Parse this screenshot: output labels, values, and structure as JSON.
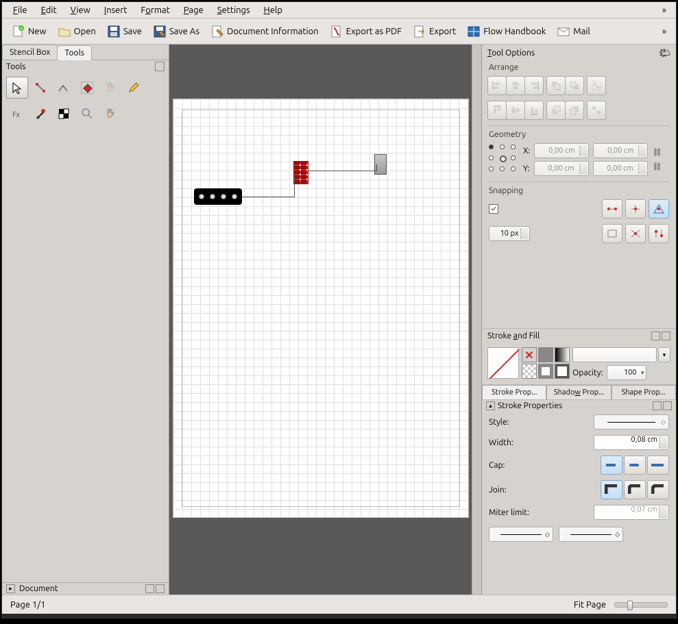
{
  "menu": {
    "items": [
      "File",
      "Edit",
      "View",
      "Insert",
      "Format",
      "Page",
      "Settings",
      "Help"
    ],
    "underline_index": [
      0,
      0,
      0,
      0,
      1,
      0,
      0,
      0
    ]
  },
  "toolbar": {
    "new": "New",
    "open": "Open",
    "save": "Save",
    "save_as": "Save As",
    "doc_info": "Document Information",
    "export_pdf": "Export as PDF",
    "export": "Export",
    "handbook": "Flow Handbook",
    "mail": "Mail"
  },
  "left": {
    "tabs": [
      "Stencil Box",
      "Tools"
    ],
    "active_tab": 1,
    "panel_title": "Tools",
    "doc_panel_title": "Document"
  },
  "tool_options": {
    "title": "Tool Options",
    "arrange_label": "Arrange",
    "geometry_label": "Geometry",
    "x_label": "X:",
    "y_label": "Y:",
    "x1": "0,00 cm",
    "y1": "0,00 cm",
    "x2": "0,00 cm",
    "y2": "0,00 cm",
    "snapping_label": "Snapping",
    "snap_checked": true,
    "snap_distance": "10 px"
  },
  "stroke_fill": {
    "title": "Stroke and Fill",
    "opacity_label": "Opacity:",
    "opacity_value": "100",
    "tabs": [
      "Stroke Prop...",
      "Shadow Prop...",
      "Shape Prop..."
    ],
    "active_tab": 0
  },
  "stroke_props": {
    "title": "Stroke Properties",
    "style_label": "Style:",
    "width_label": "Width:",
    "width_value": "0,08 cm",
    "cap_label": "Cap:",
    "join_label": "Join:",
    "miter_label": "Miter limit:",
    "miter_value": "0,07 cm"
  },
  "status": {
    "page": "Page 1/1",
    "fit": "Fit Page"
  }
}
